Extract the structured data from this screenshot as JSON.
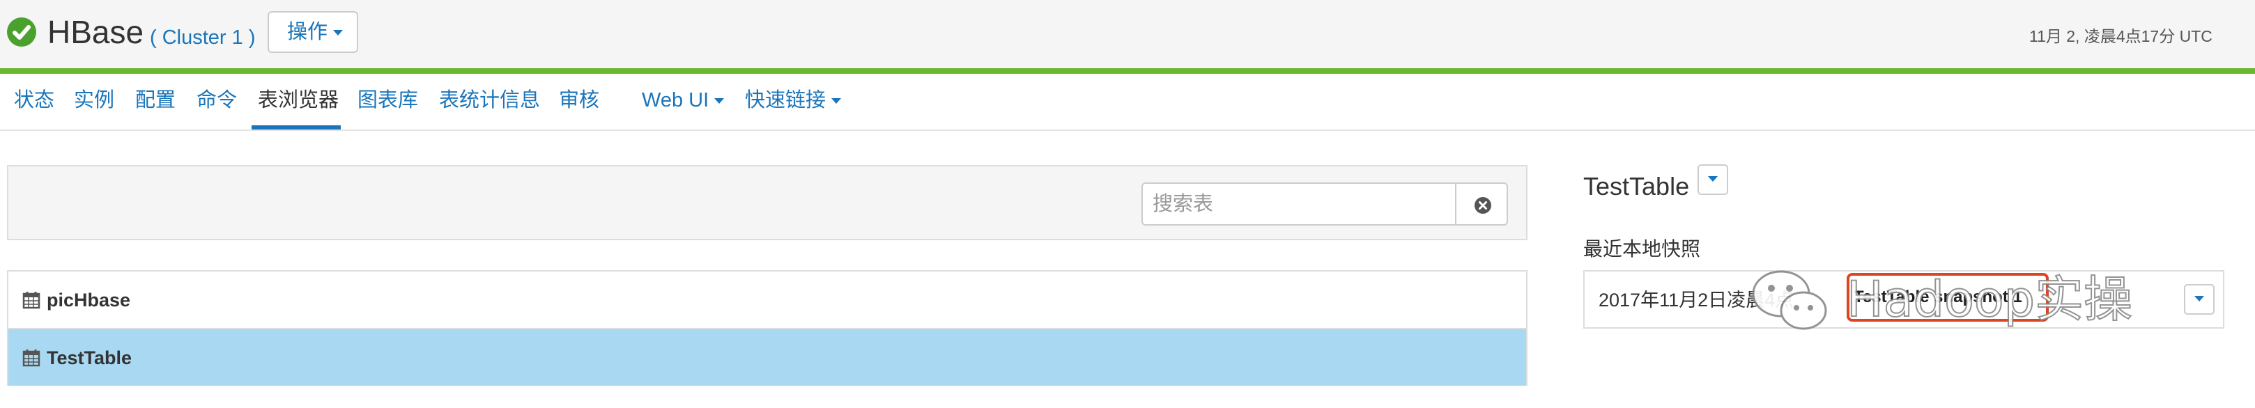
{
  "header": {
    "service_name": "HBase",
    "cluster_label": "( Cluster 1 )",
    "actions_label": "操作",
    "timestamp": "11月 2, 凌晨4点17分 UTC",
    "status_color": "#4aa12d",
    "accent_bar_color": "#6ab82d"
  },
  "nav": {
    "tabs": [
      {
        "label": "状态"
      },
      {
        "label": "实例"
      },
      {
        "label": "配置"
      },
      {
        "label": "命令"
      },
      {
        "label": "表浏览器",
        "active": true
      },
      {
        "label": "图表库"
      },
      {
        "label": "表统计信息"
      },
      {
        "label": "审核"
      },
      {
        "label": "Web UI"
      },
      {
        "label": "快速链接"
      }
    ],
    "link_color": "#1a75ba"
  },
  "search": {
    "placeholder": "搜索表",
    "value": ""
  },
  "tables": [
    {
      "name": "picHbase",
      "selected": false,
      "icon": "calendar-icon"
    },
    {
      "name": "TestTable",
      "selected": true,
      "icon": "calendar-icon"
    }
  ],
  "detail": {
    "table_title": "TestTable",
    "snapshots_label": "最近本地快照",
    "snapshot_date": "2017年11月2日凌晨4点",
    "snapshot_name": "TestTable snapshot 1",
    "selected_row_color": "#a9d9f2",
    "highlight_color": "#e0431f"
  },
  "watermark": {
    "text": "Hadoop实操"
  }
}
